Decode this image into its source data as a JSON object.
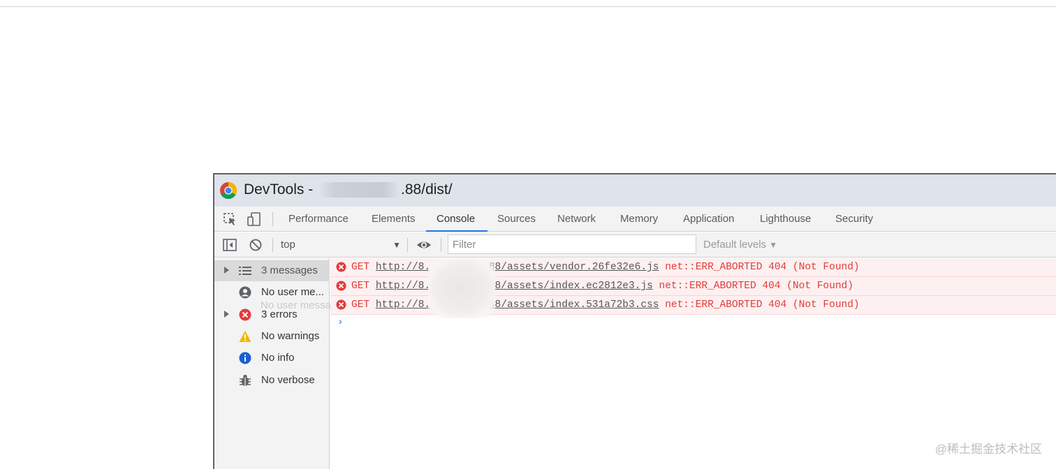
{
  "window": {
    "title_prefix": "DevTools -",
    "title_suffix": ".88/dist/"
  },
  "tabs": [
    "Performance",
    "Elements",
    "Console",
    "Sources",
    "Network",
    "Memory",
    "Application",
    "Lighthouse",
    "Security"
  ],
  "active_tab": "Console",
  "toolbar": {
    "context": "top",
    "filter_placeholder": "Filter",
    "levels": "Default levels"
  },
  "sidebar": {
    "items": [
      {
        "label": "3 messages",
        "icon": "list-icon",
        "expandable": true
      },
      {
        "label": "No user me...",
        "icon": "user-icon",
        "expandable": false
      },
      {
        "label": "3 errors",
        "icon": "error-icon",
        "expandable": true
      },
      {
        "label": "No warnings",
        "icon": "warning-icon",
        "expandable": false
      },
      {
        "label": "No info",
        "icon": "info-icon",
        "expandable": false
      },
      {
        "label": "No verbose",
        "icon": "bug-icon",
        "expandable": false
      }
    ],
    "tooltip_ghost": "No user messa"
  },
  "messages": [
    {
      "method": "GET",
      "url_prefix": "http://8.",
      "url_suffix": ":88/assets/vendor.26fe32e6.js",
      "status": "net::ERR_ABORTED 404 (Not Found)"
    },
    {
      "method": "GET",
      "url_prefix": "http://8.",
      "url_suffix": ":88/assets/index.ec2812e3.js",
      "status": "net::ERR_ABORTED 404 (Not Found)"
    },
    {
      "method": "GET",
      "url_prefix": "http://8.",
      "url_suffix": ":88/assets/index.531a72b3.css",
      "status": "net::ERR_ABORTED 404 (Not Found)"
    }
  ],
  "prompt_symbol": "›",
  "watermark": "@稀土掘金技术社区",
  "colors": {
    "error": "#e33b3b",
    "accent": "#1a73e8",
    "error_bg": "#fdf0f0"
  }
}
